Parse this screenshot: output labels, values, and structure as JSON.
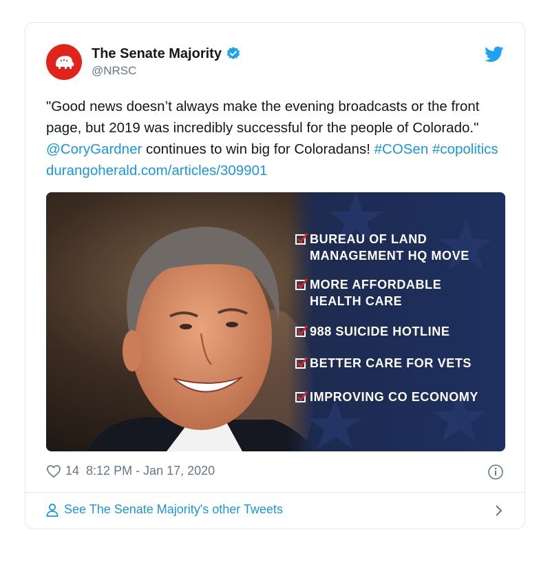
{
  "account": {
    "display_name": "The Senate Majority",
    "handle": "@NRSC",
    "verified": true
  },
  "tweet": {
    "text_parts": [
      "\"Good news doesn’t always make the evening broadcasts or the front page, but 2019 was incredibly successful for the people of Colorado.\" ",
      "@CoryGardner",
      " continues to win big for Coloradans! ",
      "#COSen",
      " ",
      "#copolitics",
      " ",
      "durangoherald.com/articles/309901"
    ]
  },
  "media": {
    "checklist": [
      "BUREAU OF LAND MANAGEMENT HQ MOVE",
      "MORE AFFORDABLE HEALTH CARE",
      "988 SUICIDE HOTLINE",
      "BETTER CARE FOR VETS",
      "IMPROVING CO ECONOMY"
    ]
  },
  "meta": {
    "likes": "14",
    "timestamp": "8:12 PM - Jan 17, 2020"
  },
  "footer": {
    "other_tweets_label": "See The Senate Majority's other Tweets"
  },
  "colors": {
    "link": "#1b95e0",
    "avatar_bg": "#e2231a",
    "media_panel": "#1b2b52",
    "check_red": "#d9262c"
  },
  "icons": {
    "avatar": "republican-elephant-logo",
    "verified": "verified-badge-icon",
    "brand": "twitter-bird-icon",
    "like": "heart-icon",
    "info": "info-icon",
    "profile": "person-icon",
    "chevron": "chevron-right-icon"
  }
}
